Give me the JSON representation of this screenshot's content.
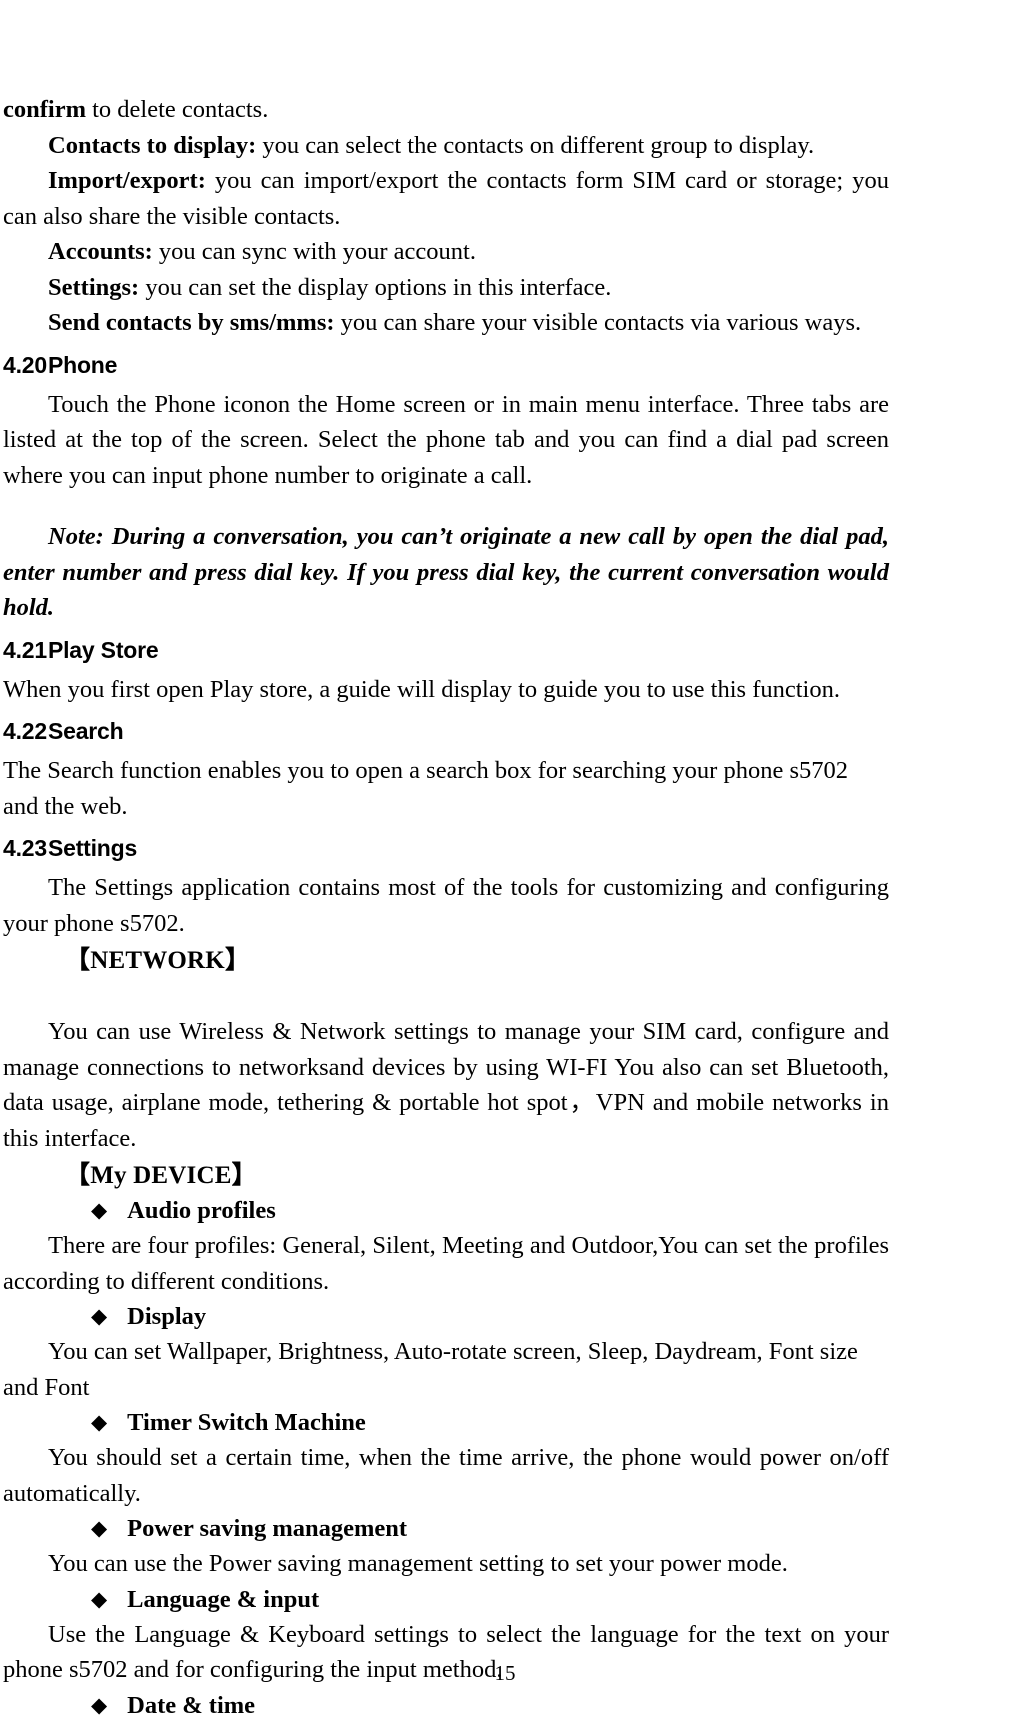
{
  "document": {
    "page_number": "15"
  },
  "body": {
    "p_confirm": {
      "bold": "confirm",
      "rest": " to delete contacts."
    },
    "p_contacts_to_display": {
      "bold": "Contacts to display:",
      "rest": " you can select the contacts on different group to display."
    },
    "p_import_export": {
      "bold": "Import/export:",
      "rest": " you can import/export the contacts form SIM card or storage; you can also share the visible contacts."
    },
    "p_accounts": {
      "bold": "Accounts:",
      "rest": " you can sync with your account."
    },
    "p_settings": {
      "bold": "Settings:",
      "rest": " you can set the display options in this interface."
    },
    "p_send_contacts": {
      "bold": "Send contacts by sms/mms:",
      "rest": " you can share your visible contacts via various ways."
    }
  },
  "sections": {
    "phone": {
      "number": "4.20",
      "title": "Phone",
      "paragraph": "Touch the Phone iconon the Home screen or in main menu interface. Three tabs are listed at the top of the screen. Select the phone tab and you can find a dial pad screen where you can input phone number to originate a call.",
      "note": "Note: During a conversation, you can’t originate a new call by open the dial pad, enter number and press dial key. If you press dial key, the current conversation would hold."
    },
    "play_store": {
      "number": "4.21",
      "title": "Play Store",
      "paragraph": "When you first open  Play store, a guide will display to guide you to use this function."
    },
    "search": {
      "number": "4.22",
      "title": "Search",
      "paragraph": "The Search function enables you to open a search box for searching your phone s5702 and the web."
    },
    "settings": {
      "number": "4.23",
      "title": "Settings",
      "intro": "The Settings application contains most of the tools for customizing and configuring your phone s5702.",
      "groups": [
        {
          "title": "【NETWORK】",
          "bracket_open": "【",
          "bracket_close": "】",
          "label": "NETWORK",
          "paragraph": "You can use Wireless & Network settings to manage your SIM card, configure and manage connections to networksand devices by using WI-FI You also can set Bluetooth, data usage, airplane mode, tethering & portable hot spot，VPN and mobile networks in this interface.",
          "items": []
        },
        {
          "title": "【My DEVICE】",
          "bracket_open": "【",
          "bracket_close": "】",
          "label": "My DEVICE",
          "paragraph": "",
          "items": [
            {
              "bullet": "◆",
              "name": "Audio profiles",
              "description": "There are four profiles: General, Silent, Meeting and Outdoor,You can set the profiles according to different conditions.",
              "desc_indent": "indent"
            },
            {
              "bullet": "◆",
              "name": "Display",
              "description": "You can set Wallpaper, Brightness, Auto-rotate screen, Sleep, Daydream, Font size and Font",
              "desc_indent": "small"
            },
            {
              "bullet": "◆",
              "name": "Timer Switch Machine",
              "description": "You should set a certain time, when the time arrive, the phone would power on/off automatically.",
              "desc_indent": "indent"
            },
            {
              "bullet": "◆",
              "name": "Power saving management",
              "description": "You can use the Power saving management setting to set your power mode.",
              "desc_indent": "small"
            },
            {
              "bullet": "◆",
              "name": "Language & input",
              "description": "Use the Language & Keyboard settings to select the language for the text on your phone s5702 and for configuring the input method.",
              "desc_indent": "small"
            },
            {
              "bullet": "◆",
              "name": "Date & time",
              "description": "",
              "desc_indent": "none"
            }
          ]
        }
      ]
    }
  }
}
